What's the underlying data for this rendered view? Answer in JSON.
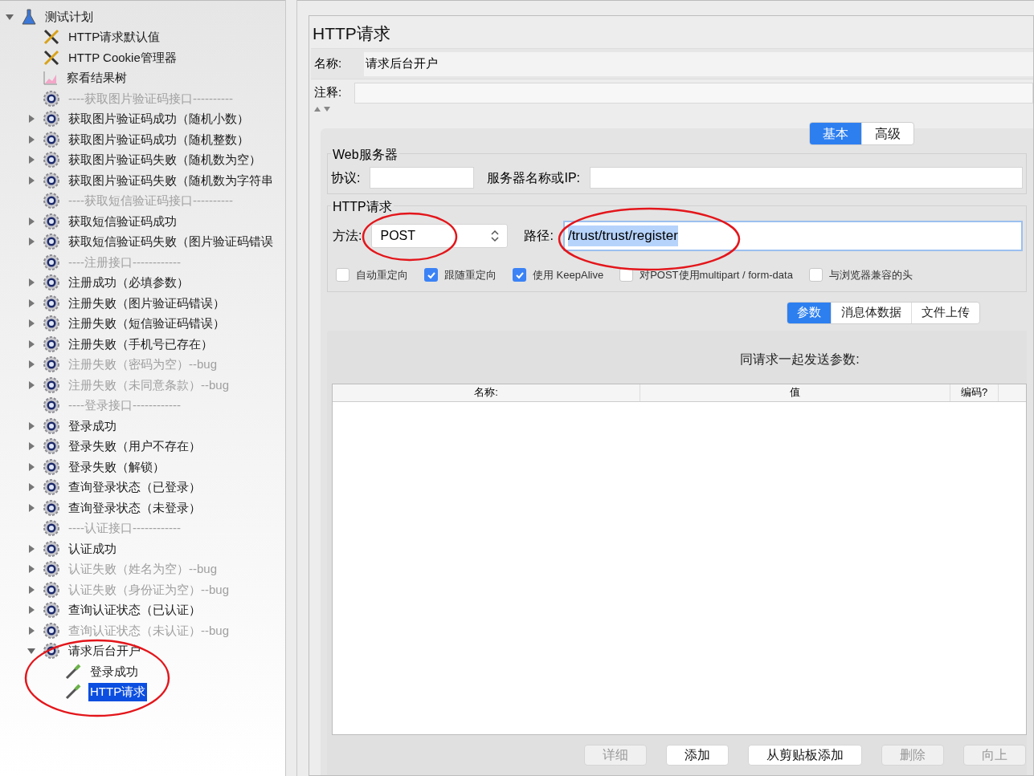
{
  "tree": {
    "label": "测试计划",
    "kind": "plan",
    "expanded": true,
    "selected": false,
    "disabled": false,
    "children": [
      {
        "label": "HTTP请求默认值",
        "kind": "config",
        "selected": false,
        "disabled": false
      },
      {
        "label": "HTTP Cookie管理器",
        "kind": "config",
        "selected": false,
        "disabled": false
      },
      {
        "label": "察看结果树",
        "kind": "listener",
        "selected": false,
        "disabled": false
      },
      {
        "label": "----获取图片验证码接口----------",
        "kind": "controller",
        "selected": false,
        "disabled": true
      },
      {
        "label": "获取图片验证码成功（随机小数）",
        "kind": "controller",
        "expanded": false,
        "selected": false,
        "disabled": false
      },
      {
        "label": "获取图片验证码成功（随机整数）",
        "kind": "controller",
        "expanded": false,
        "selected": false,
        "disabled": false
      },
      {
        "label": "获取图片验证码失败（随机数为空）",
        "kind": "controller",
        "expanded": false,
        "selected": false,
        "disabled": false
      },
      {
        "label": "获取图片验证码失败（随机数为字符串",
        "kind": "controller",
        "expanded": false,
        "selected": false,
        "disabled": false
      },
      {
        "label": "----获取短信验证码接口----------",
        "kind": "controller",
        "selected": false,
        "disabled": true
      },
      {
        "label": "获取短信验证码成功",
        "kind": "controller",
        "expanded": false,
        "selected": false,
        "disabled": false
      },
      {
        "label": "获取短信验证码失败（图片验证码错误",
        "kind": "controller",
        "expanded": false,
        "selected": false,
        "disabled": false
      },
      {
        "label": "----注册接口------------",
        "kind": "controller",
        "selected": false,
        "disabled": true
      },
      {
        "label": "注册成功（必填参数）",
        "kind": "controller",
        "expanded": false,
        "selected": false,
        "disabled": false
      },
      {
        "label": "注册失败（图片验证码错误）",
        "kind": "controller",
        "expanded": false,
        "selected": false,
        "disabled": false
      },
      {
        "label": "注册失败（短信验证码错误）",
        "kind": "controller",
        "expanded": false,
        "selected": false,
        "disabled": false
      },
      {
        "label": "注册失败（手机号已存在）",
        "kind": "controller",
        "expanded": false,
        "selected": false,
        "disabled": false
      },
      {
        "label": "注册失败（密码为空）--bug",
        "kind": "controller",
        "expanded": false,
        "selected": false,
        "disabled": true
      },
      {
        "label": "注册失败（未同意条款）--bug",
        "kind": "controller",
        "expanded": false,
        "selected": false,
        "disabled": true
      },
      {
        "label": "----登录接口------------",
        "kind": "controller",
        "selected": false,
        "disabled": true
      },
      {
        "label": "登录成功",
        "kind": "controller",
        "expanded": false,
        "selected": false,
        "disabled": false
      },
      {
        "label": "登录失败（用户不存在）",
        "kind": "controller",
        "expanded": false,
        "selected": false,
        "disabled": false
      },
      {
        "label": "登录失败（解锁）",
        "kind": "controller",
        "expanded": false,
        "selected": false,
        "disabled": false
      },
      {
        "label": "查询登录状态（已登录）",
        "kind": "controller",
        "expanded": false,
        "selected": false,
        "disabled": false
      },
      {
        "label": "查询登录状态（未登录）",
        "kind": "controller",
        "expanded": false,
        "selected": false,
        "disabled": false
      },
      {
        "label": "----认证接口------------",
        "kind": "controller",
        "selected": false,
        "disabled": true
      },
      {
        "label": "认证成功",
        "kind": "controller",
        "expanded": false,
        "selected": false,
        "disabled": false
      },
      {
        "label": "认证失败（姓名为空）--bug",
        "kind": "controller",
        "expanded": false,
        "selected": false,
        "disabled": true
      },
      {
        "label": "认证失败（身份证为空）--bug",
        "kind": "controller",
        "expanded": false,
        "selected": false,
        "disabled": true
      },
      {
        "label": "查询认证状态（已认证）",
        "kind": "controller",
        "expanded": false,
        "selected": false,
        "disabled": false
      },
      {
        "label": "查询认证状态（未认证）--bug",
        "kind": "controller",
        "expanded": false,
        "selected": false,
        "disabled": true
      },
      {
        "label": "请求后台开户",
        "kind": "controller",
        "expanded": true,
        "selected": false,
        "disabled": false,
        "children": [
          {
            "label": "登录成功",
            "kind": "sampler",
            "selected": false,
            "disabled": false
          },
          {
            "label": "HTTP请求",
            "kind": "sampler",
            "selected": true,
            "disabled": false
          }
        ]
      }
    ]
  },
  "panel": {
    "title": "HTTP请求",
    "name_label": "名称:",
    "name_value": "请求后台开户",
    "comment_label": "注释:",
    "tabs": [
      {
        "label": "基本",
        "selected": true
      },
      {
        "label": "高级",
        "selected": false
      }
    ],
    "web_server": {
      "legend": "Web服务器",
      "protocol_label": "协议:",
      "server_label": "服务器名称或IP:"
    },
    "http_request": {
      "legend": "HTTP请求",
      "method_label": "方法:",
      "method_value": "POST",
      "path_label": "路径:",
      "path_value": "/trust/trust/register"
    },
    "options": [
      {
        "label": "自动重定向",
        "checked": false
      },
      {
        "label": "跟随重定向",
        "checked": true
      },
      {
        "label": "使用 KeepAlive",
        "checked": true
      },
      {
        "label": "对POST使用multipart / form-data",
        "checked": false
      },
      {
        "label": "与浏览器兼容的头",
        "checked": false
      }
    ],
    "sub_tabs": [
      {
        "label": "参数",
        "selected": true
      },
      {
        "label": "消息体数据",
        "selected": false
      },
      {
        "label": "文件上传",
        "selected": false
      }
    ],
    "params_caption": "同请求一起发送参数:",
    "table": {
      "columns": [
        "名称:",
        "值",
        "编码?"
      ]
    },
    "buttons": [
      {
        "label": "详细",
        "disabled": true
      },
      {
        "label": "添加",
        "disabled": false
      },
      {
        "label": "从剪贴板添加",
        "disabled": false
      },
      {
        "label": "删除",
        "disabled": true
      },
      {
        "label": "向上",
        "disabled": true
      }
    ]
  }
}
